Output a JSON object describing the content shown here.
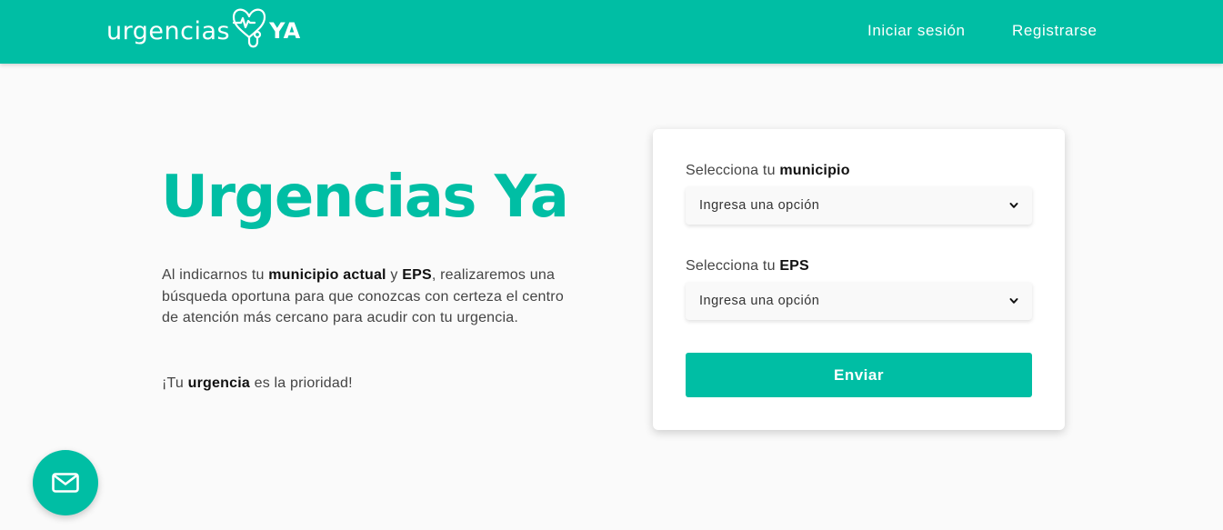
{
  "brand": {
    "logo_word": "urgencias",
    "logo_suffix": "YA",
    "primary_color": "#00bea4"
  },
  "nav": {
    "login_label": "Iniciar sesión",
    "register_label": "Registrarse"
  },
  "hero": {
    "title": "Urgencias Ya",
    "intro_1": "Al indicarnos tu ",
    "intro_bold_1": "municipio actual",
    "intro_2": " y ",
    "intro_bold_2": "EPS",
    "intro_3": ", realizaremos una búsqueda oportuna para que conozcas con certeza el centro de atención más cercano para acudir con tu urgencia.",
    "tagline_1": "¡Tu ",
    "tagline_bold": "urgencia",
    "tagline_2": " es la prioridad!"
  },
  "form": {
    "municipio_label_prefix": "Selecciona tu ",
    "municipio_label_bold": "municipio",
    "municipio_value": "Ingresa una opción",
    "eps_label_prefix": "Selecciona tu ",
    "eps_label_bold": "EPS",
    "eps_value": "Ingresa una opción",
    "submit_label": "Enviar"
  },
  "icons": {
    "logo_mark": "heart-stethoscope-icon",
    "select_arrow": "chevron-down-icon",
    "contact": "envelope-icon"
  }
}
